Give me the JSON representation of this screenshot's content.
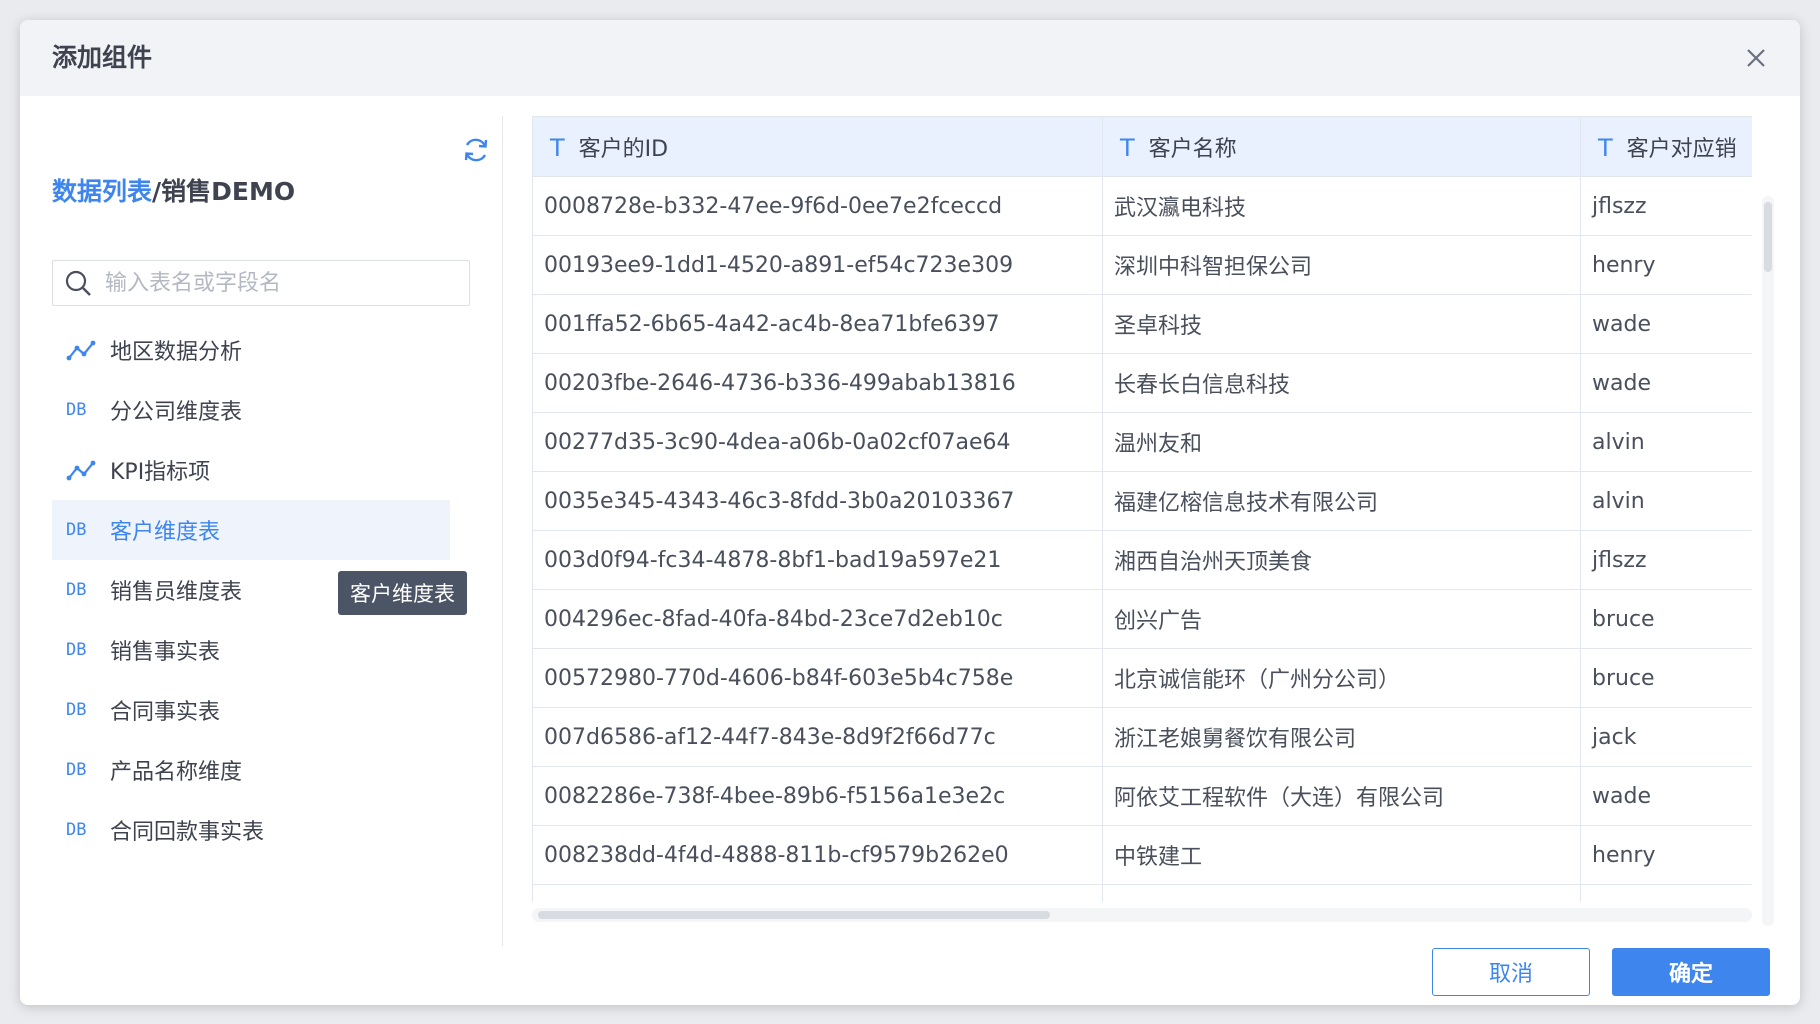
{
  "dialog": {
    "title": "添加组件",
    "cancel_label": "取消",
    "ok_label": "确定"
  },
  "left_panel": {
    "breadcrumb": {
      "link": "数据列表",
      "separator": "/",
      "current": "销售DEMO"
    },
    "search": {
      "placeholder": "输入表名或字段名",
      "value": ""
    },
    "items": [
      {
        "label": "地区数据分析",
        "icon": "analysis-icon",
        "selected": false
      },
      {
        "label": "分公司维度表",
        "icon": "DB",
        "selected": false
      },
      {
        "label": "KPI指标项",
        "icon": "analysis-icon",
        "selected": false
      },
      {
        "label": "客户维度表",
        "icon": "DB",
        "selected": true
      },
      {
        "label": "销售员维度表",
        "icon": "DB",
        "selected": false
      },
      {
        "label": "销售事实表",
        "icon": "DB",
        "selected": false
      },
      {
        "label": "合同事实表",
        "icon": "DB",
        "selected": false
      },
      {
        "label": "产品名称维度",
        "icon": "DB",
        "selected": false
      },
      {
        "label": "合同回款事实表",
        "icon": "DB",
        "selected": false
      }
    ],
    "tooltip": "客户维度表"
  },
  "table": {
    "type_glyph": "T",
    "columns": [
      "客户的ID",
      "客户名称",
      "客户对应销"
    ],
    "rows": [
      [
        "0008728e-b332-47ee-9f6d-0ee7e2fceccd",
        "武汉瀛电科技",
        "jflszz"
      ],
      [
        "00193ee9-1dd1-4520-a891-ef54c723e309",
        "深圳中科智担保公司",
        "henry"
      ],
      [
        "001ffa52-6b65-4a42-ac4b-8ea71bfe6397",
        "圣卓科技",
        "wade"
      ],
      [
        "00203fbe-2646-4736-b336-499abab13816",
        "长春长白信息科技",
        "wade"
      ],
      [
        "00277d35-3c90-4dea-a06b-0a02cf07ae64",
        "温州友和",
        "alvin"
      ],
      [
        "0035e345-4343-46c3-8fdd-3b0a20103367",
        "福建亿榕信息技术有限公司",
        "alvin"
      ],
      [
        "003d0f94-fc34-4878-8bf1-bad19a597e21",
        "湘西自治州天顶美食",
        "jflszz"
      ],
      [
        "004296ec-8fad-40fa-84bd-23ce7d2eb10c",
        "创兴广告",
        "bruce"
      ],
      [
        "00572980-770d-4606-b84f-603e5b4c758e",
        "北京诚信能环（广州分公司）",
        "bruce"
      ],
      [
        "007d6586-af12-44f7-843e-8d9f2f66d77c",
        "浙江老娘舅餐饮有限公司",
        "jack"
      ],
      [
        "0082286e-738f-4bee-89b6-f5156a1e3e2c",
        "阿依艾工程软件（大连）有限公司",
        "wade"
      ],
      [
        "008238dd-4f4d-4888-811b-cf9579b262e0",
        "中铁建工",
        "henry"
      ],
      [
        "",
        "",
        ""
      ]
    ]
  },
  "colors": {
    "accent": "#3e86ee",
    "header_bg": "#e8f1fd",
    "selected_bg": "#eef3fc",
    "tooltip_bg": "#4c5566"
  }
}
